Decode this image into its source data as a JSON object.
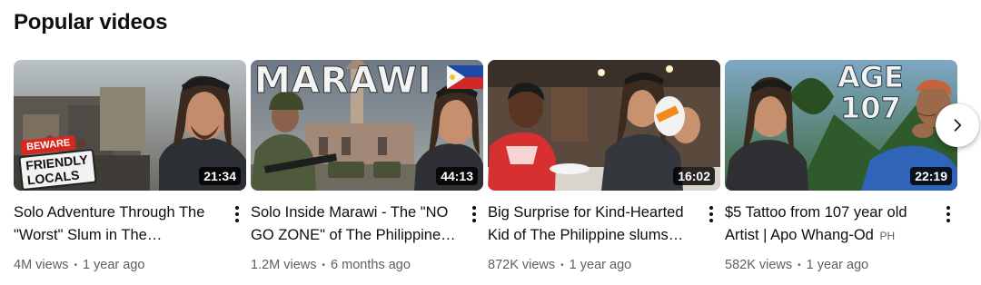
{
  "section": {
    "title": "Popular videos"
  },
  "videos": [
    {
      "title": "Solo Adventure Through The \"Worst\" Slum in The…",
      "duration": "21:34",
      "views": "4M views",
      "age": "1 year ago",
      "thumb_text": [
        "BEWARE",
        "FRIENDLY",
        "LOCALS"
      ]
    },
    {
      "title": "Solo Inside Marawi - The \"NO GO ZONE\" of The Philippine…",
      "duration": "44:13",
      "views": "1.2M views",
      "age": "6 months ago",
      "thumb_text": "MARAWI"
    },
    {
      "title": "Big Surprise for Kind-Hearted Kid of The Philippine slums…",
      "duration": "16:02",
      "views": "872K views",
      "age": "1 year ago"
    },
    {
      "title": "$5 Tattoo from 107 year old Artist | Apo Whang-Od",
      "badge": "PH",
      "duration": "22:19",
      "views": "582K views",
      "age": "1 year ago",
      "thumb_text": [
        "AGE",
        "107"
      ]
    }
  ],
  "icons": {
    "more": "more-vert-icon",
    "next": "chevron-right-icon"
  }
}
